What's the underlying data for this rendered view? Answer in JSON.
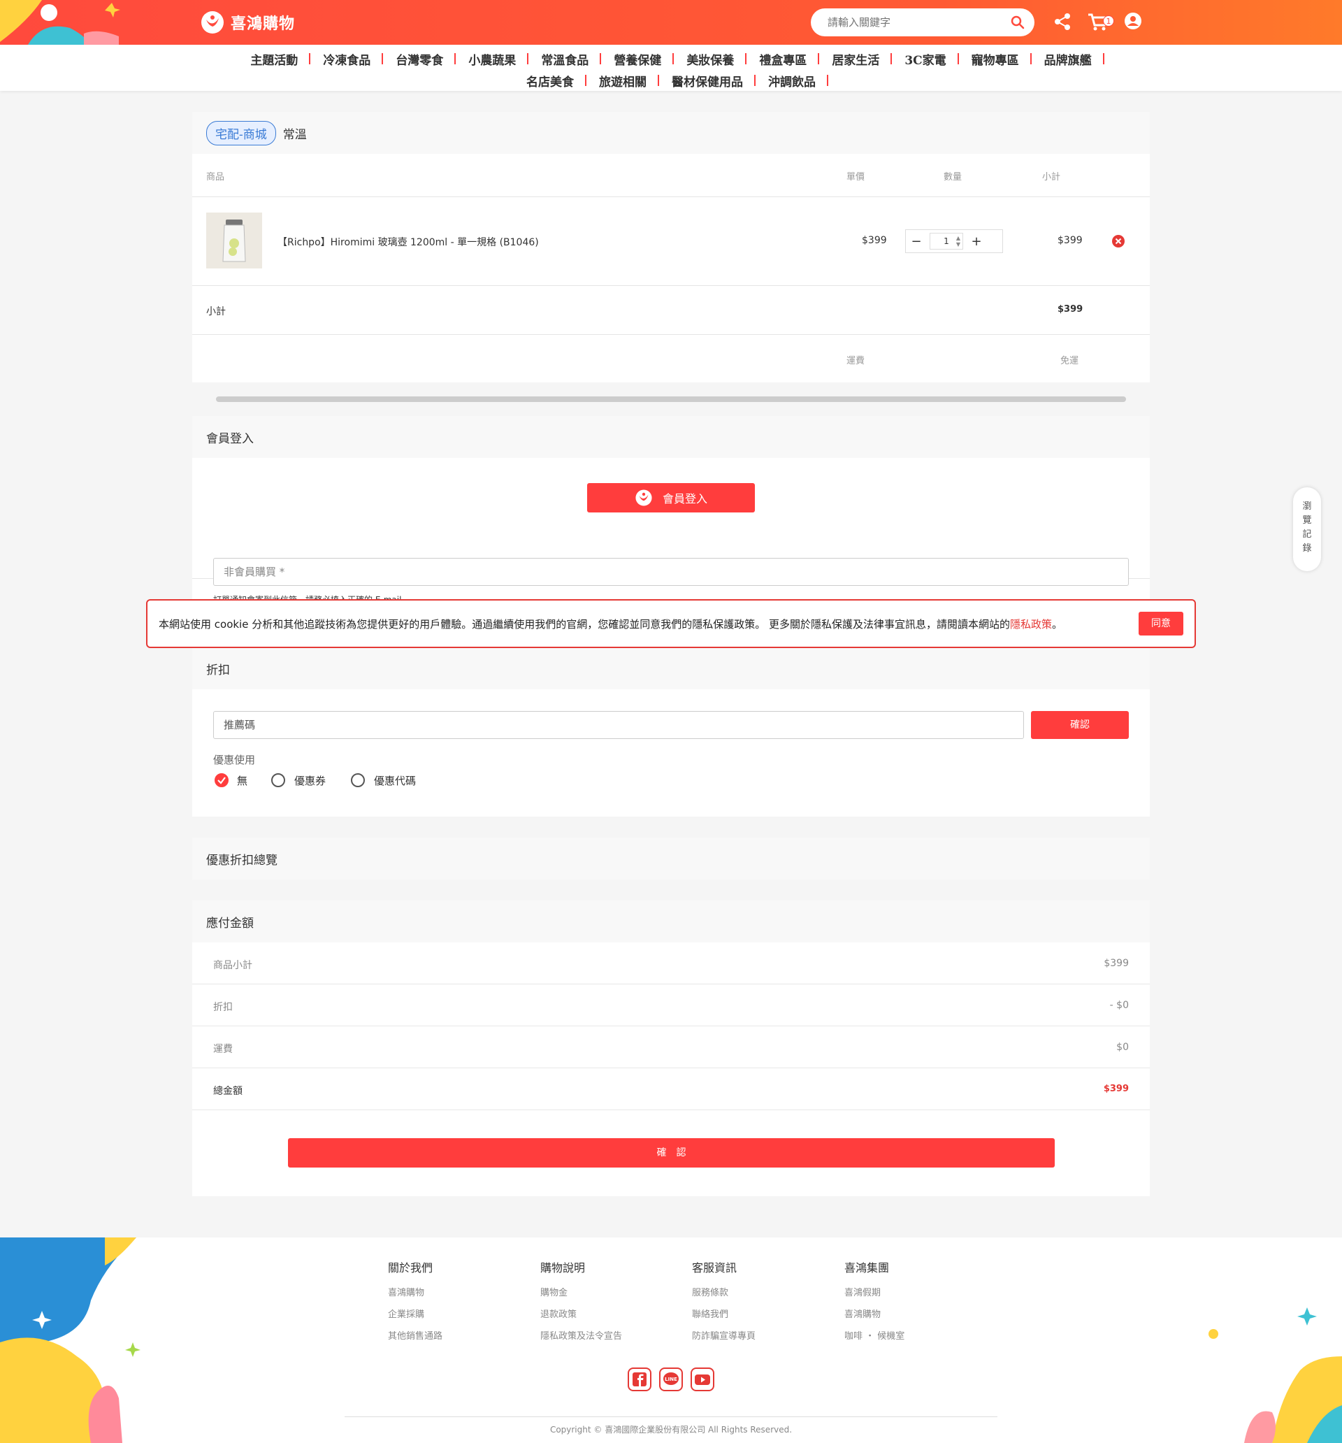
{
  "header": {
    "logo_text": "喜鴻購物",
    "search_placeholder": "請輸入關鍵字",
    "cart_count": "1"
  },
  "nav": {
    "row1": [
      "主題活動",
      "冷凍食品",
      "台灣零食",
      "小農蔬果",
      "常溫食品",
      "營養保健",
      "美妝保養",
      "禮盒專區",
      "居家生活",
      "3C家電",
      "寵物專區",
      "品牌旗艦"
    ],
    "row2": [
      "名店美食",
      "旅遊相關",
      "醫材保健用品",
      "沖調飲品"
    ]
  },
  "cart": {
    "tag": "宅配-商城",
    "temp": "常溫",
    "columns": {
      "product": "商品",
      "price": "單價",
      "qty": "數量",
      "subtotal": "小計"
    },
    "item": {
      "name": "【Richpo】Hiromimi 玻璃壺 1200ml - 單一規格 (B1046)",
      "price": "$399",
      "qty": "1",
      "subtotal": "$399"
    },
    "subtotal_label": "小計",
    "subtotal_value": "$399",
    "shipping_label": "運費",
    "shipping_value": "免運"
  },
  "login": {
    "title": "會員登入",
    "button": "會員登入",
    "guest_placeholder": "非會員購買 *",
    "guest_hint": "訂單通知會寄到此信箱，請務必填入正確的 E-mail"
  },
  "cookie": {
    "text": "本網站使用 cookie 分析和其他追蹤技術為您提供更好的用戶體驗。通過繼續使用我們的官網，您確認並同意我們的隱私保護政策。 更多關於隱私保護及法律事宜訊息，請閱讀本網站的",
    "link": "隱私政策",
    "end": "。",
    "agree": "同意"
  },
  "discount": {
    "title": "折扣",
    "code_placeholder": "推薦碼",
    "confirm": "確認",
    "use_label": "優惠使用",
    "options": [
      "無",
      "優惠券",
      "優惠代碼"
    ],
    "selected": "無"
  },
  "discount_overview": {
    "title": "優惠折扣總覽"
  },
  "payment": {
    "title": "應付金額",
    "rows": [
      {
        "label": "商品小計",
        "value": "$399"
      },
      {
        "label": "折扣",
        "value": "- $0"
      },
      {
        "label": "運費",
        "value": "$0"
      },
      {
        "label": "總金額",
        "value": "$399"
      }
    ],
    "confirm": "確　認"
  },
  "side_tab": "瀏覽記錄",
  "footer": {
    "cols": [
      {
        "title": "關於我們",
        "items": [
          "喜鴻購物",
          "企業採購",
          "其他銷售通路"
        ]
      },
      {
        "title": "購物說明",
        "items": [
          "購物金",
          "退款政策",
          "隱私政策及法令宣告"
        ]
      },
      {
        "title": "客服資訊",
        "items": [
          "服務條款",
          "聯絡我們",
          "防詐騙宣導專頁"
        ]
      },
      {
        "title": "喜鴻集團",
        "items": [
          "喜鴻假期",
          "喜鴻購物",
          "咖啡 ・ 候機室"
        ]
      }
    ],
    "copyright": "Copyright © 喜鴻國際企業股份有限公司 All Rights Reserved.",
    "social": [
      "facebook-icon",
      "line-icon",
      "youtube-icon"
    ]
  },
  "colors": {
    "accent": "#ff3d3d",
    "tag_blue": "#3a7bd5",
    "total_red": "#e53935"
  }
}
